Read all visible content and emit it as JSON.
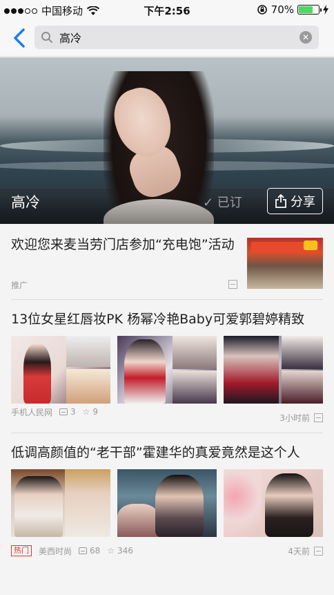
{
  "status": {
    "carrier": "中国移动",
    "time": "下午2:56",
    "battery": "70%",
    "battery_level": 0.7
  },
  "search": {
    "query": "高冷"
  },
  "hero": {
    "title": "高冷",
    "subscribed_label": "✓ 已订",
    "share_label": "分享"
  },
  "feed": {
    "ad": {
      "headline": "欢迎您来麦当劳门店参加“充电饱”活动",
      "tag": "推广"
    },
    "article1": {
      "headline": "13位女星红唇妆PK 杨幂冷艳Baby可爱郭碧婷精致",
      "source": "手机人民网",
      "comments": "3",
      "favorites": "9",
      "time": "3小时前"
    },
    "article2": {
      "headline": "低调高颜值的“老干部”霍建华的真爱竟然是这个人",
      "hot_tag": "热门",
      "source": "美西时尚",
      "comments": "68",
      "favorites": "346",
      "time": "4天前"
    }
  }
}
